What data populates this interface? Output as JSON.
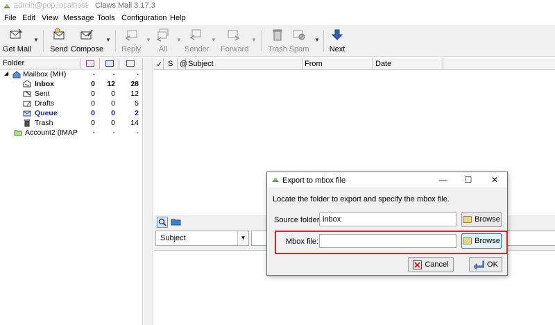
{
  "titlebar": {
    "account": "admin@pop.localhost",
    "separator": "-",
    "app_name": "Claws Mail 3.17.3"
  },
  "menu": [
    "File",
    "Edit",
    "View",
    "Message",
    "Tools",
    "Configuration",
    "Help"
  ],
  "toolbar": {
    "get_mail": "Get Mail",
    "send": "Send",
    "compose": "Compose",
    "reply": "Reply",
    "all": "All",
    "sender": "Sender",
    "forward": "Forward",
    "trash": "Trash",
    "spam": "Spam",
    "next": "Next"
  },
  "folder_pane": {
    "header": "Folder",
    "rows": [
      {
        "name": "Mailbox (MH)",
        "new": "-",
        "unread": "-",
        "total": "-"
      },
      {
        "name": "Inbox",
        "new": "0",
        "unread": "12",
        "total": "28"
      },
      {
        "name": "Sent",
        "new": "0",
        "unread": "0",
        "total": "12"
      },
      {
        "name": "Drafts",
        "new": "0",
        "unread": "0",
        "total": "5"
      },
      {
        "name": "Queue",
        "new": "0",
        "unread": "0",
        "total": "2"
      },
      {
        "name": "Trash",
        "new": "0",
        "unread": "0",
        "total": "14"
      },
      {
        "name": "Account2 (IMAP",
        "new": "-",
        "unread": "-",
        "total": "-"
      }
    ]
  },
  "message_list": {
    "columns": [
      "✓",
      "S",
      "@",
      "Subject",
      "From",
      "Date"
    ]
  },
  "quick_search": {
    "field": "Subject"
  },
  "dialog": {
    "title": "Export to mbox file",
    "description": "Locate the folder to export and specify the mbox file.",
    "source_label": "Source folder:",
    "source_value": "inbox",
    "mbox_label": "Mbox file:",
    "mbox_value": "",
    "browse1": "Browse",
    "browse2": "Browse",
    "cancel": "Cancel",
    "ok": "OK"
  }
}
